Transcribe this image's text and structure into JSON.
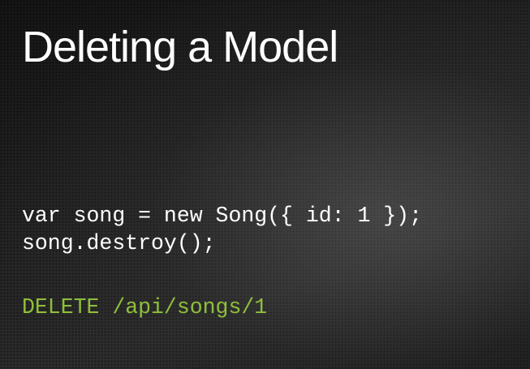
{
  "slide": {
    "title": "Deleting a Model",
    "code_lines": [
      "var song = new Song({ id: 1 });",
      "song.destroy();"
    ],
    "request": "DELETE /api/songs/1",
    "colors": {
      "title": "#ffffff",
      "code": "#ffffff",
      "request": "#8fbf3a"
    }
  }
}
